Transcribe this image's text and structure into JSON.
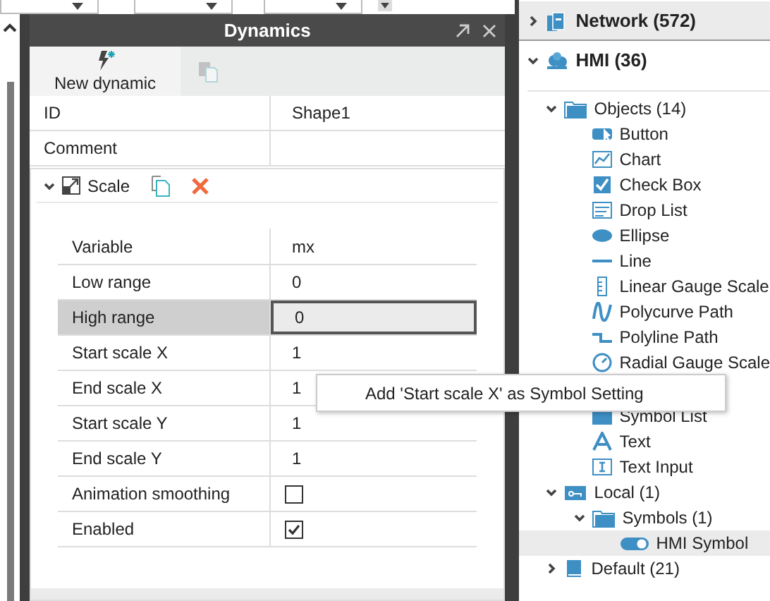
{
  "panel": {
    "title": "Dynamics",
    "toolbar": [
      {
        "label": "New dynamic",
        "disabled": false
      },
      {
        "disabled": true
      }
    ],
    "properties": [
      {
        "name": "ID",
        "value": "Shape1"
      },
      {
        "name": "Comment"
      }
    ],
    "section": {
      "title": "Scale",
      "expanded": true,
      "rows": [
        {
          "name": "Variable",
          "kind": "text",
          "value": "mx",
          "selected": false
        },
        {
          "name": "Low range",
          "kind": "text",
          "value": "0",
          "selected": false
        },
        {
          "name": "High range",
          "kind": "text",
          "value": "0",
          "selected": true
        },
        {
          "name": "Start scale X",
          "kind": "text",
          "value": "1",
          "selected": false
        },
        {
          "name": "End scale X",
          "kind": "text",
          "value": "1",
          "selected": false
        },
        {
          "name": "Start scale Y",
          "kind": "text",
          "value": "1",
          "selected": false
        },
        {
          "name": "End scale Y",
          "kind": "text",
          "value": "1",
          "selected": false
        },
        {
          "name": "Animation smoothing",
          "kind": "checkbox",
          "checked": false,
          "selected": false
        },
        {
          "name": "Enabled",
          "kind": "checkbox",
          "checked": true,
          "selected": false
        }
      ]
    }
  },
  "context_menu": {
    "items": [
      "Add 'Start scale X' as Symbol Setting"
    ]
  },
  "tree": [
    {
      "label": "Network (572)",
      "expanded": false,
      "selected": true
    },
    {
      "label": "HMI (36)",
      "expanded": true,
      "selected": false,
      "children": [
        {
          "label": "Objects (14)",
          "expanded": true,
          "selected": false,
          "children": [
            {
              "label": "Button",
              "selected": false
            },
            {
              "label": "Chart",
              "selected": false
            },
            {
              "label": "Check Box",
              "selected": false
            },
            {
              "label": "Drop List",
              "selected": false
            },
            {
              "label": "Ellipse",
              "selected": false
            },
            {
              "label": "Line",
              "selected": false
            },
            {
              "label": "Linear Gauge Scale",
              "selected": false
            },
            {
              "label": "Polycurve Path",
              "selected": false
            },
            {
              "label": "Polyline Path",
              "selected": false
            },
            {
              "label": "Radial Gauge Scale",
              "selected": false
            },
            {
              "label": "Symbol List",
              "selected": false
            },
            {
              "label": "Text",
              "selected": false
            },
            {
              "label": "Text Input",
              "selected": false
            }
          ]
        },
        {
          "label": "Local (1)",
          "expanded": true,
          "selected": false,
          "children": [
            {
              "label": "Symbols (1)",
              "expanded": true,
              "selected": false,
              "children": [
                {
                  "label": "HMI Symbol",
                  "selected": true
                }
              ]
            }
          ]
        },
        {
          "label": "Default (21)",
          "expanded": false,
          "selected": false
        }
      ]
    }
  ]
}
